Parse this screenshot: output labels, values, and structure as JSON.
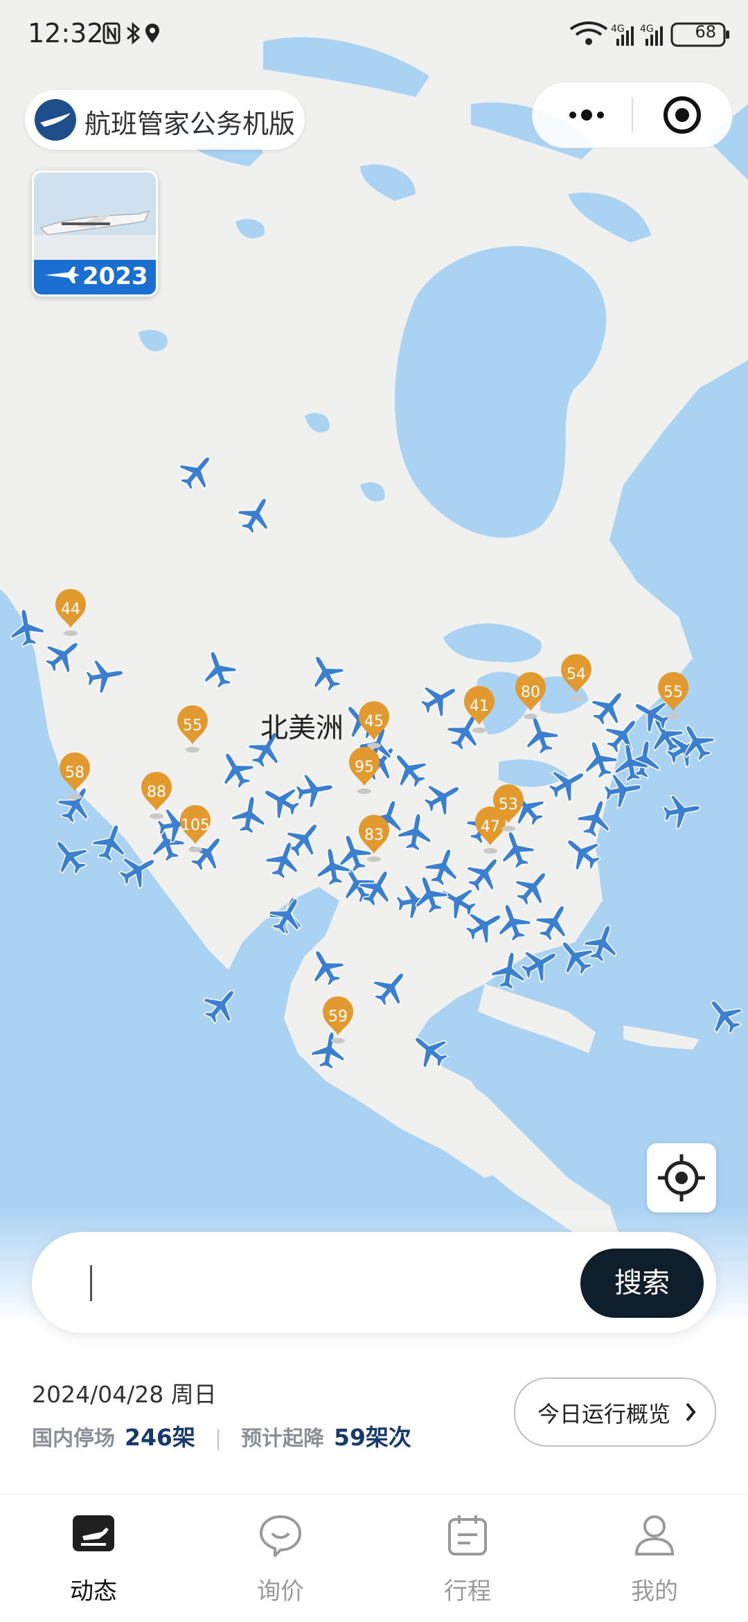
{
  "status_bar": {
    "time": "12:32",
    "battery": "68",
    "network_1": "4G",
    "network_2": "4G"
  },
  "mini_program": {
    "title": "航班管家公务机版"
  },
  "promo": {
    "year": "2023"
  },
  "map": {
    "region_label": "北美洲",
    "markers": [
      {
        "value": "44"
      },
      {
        "value": "55"
      },
      {
        "value": "45"
      },
      {
        "value": "41"
      },
      {
        "value": "80"
      },
      {
        "value": "54"
      },
      {
        "value": "55"
      },
      {
        "value": "58"
      },
      {
        "value": "88"
      },
      {
        "value": "105"
      },
      {
        "value": "95"
      },
      {
        "value": "47"
      },
      {
        "value": "53"
      },
      {
        "value": "83"
      },
      {
        "value": "59"
      }
    ]
  },
  "search": {
    "placeholder": "",
    "button_label": "搜索"
  },
  "summary": {
    "date": "2024/04/28 周日",
    "parked_label": "国内停场",
    "parked_value": "246架",
    "flights_label": "预计起降",
    "flights_value": "59架次",
    "overview_button": "今日运行概览"
  },
  "tabs": [
    {
      "label": "动态",
      "icon": "flight-status-icon",
      "active": true
    },
    {
      "label": "询价",
      "icon": "chat-bubble-icon",
      "active": false
    },
    {
      "label": "行程",
      "icon": "calendar-icon",
      "active": false
    },
    {
      "label": "我的",
      "icon": "user-icon",
      "active": false
    }
  ],
  "colors": {
    "ocean": "#a9d2f3",
    "land": "#f0f0ee",
    "plane": "#3b7fd0",
    "marker": "#e29a2f",
    "search_button": "#0f1e2b",
    "stat_value": "#173a6a"
  }
}
